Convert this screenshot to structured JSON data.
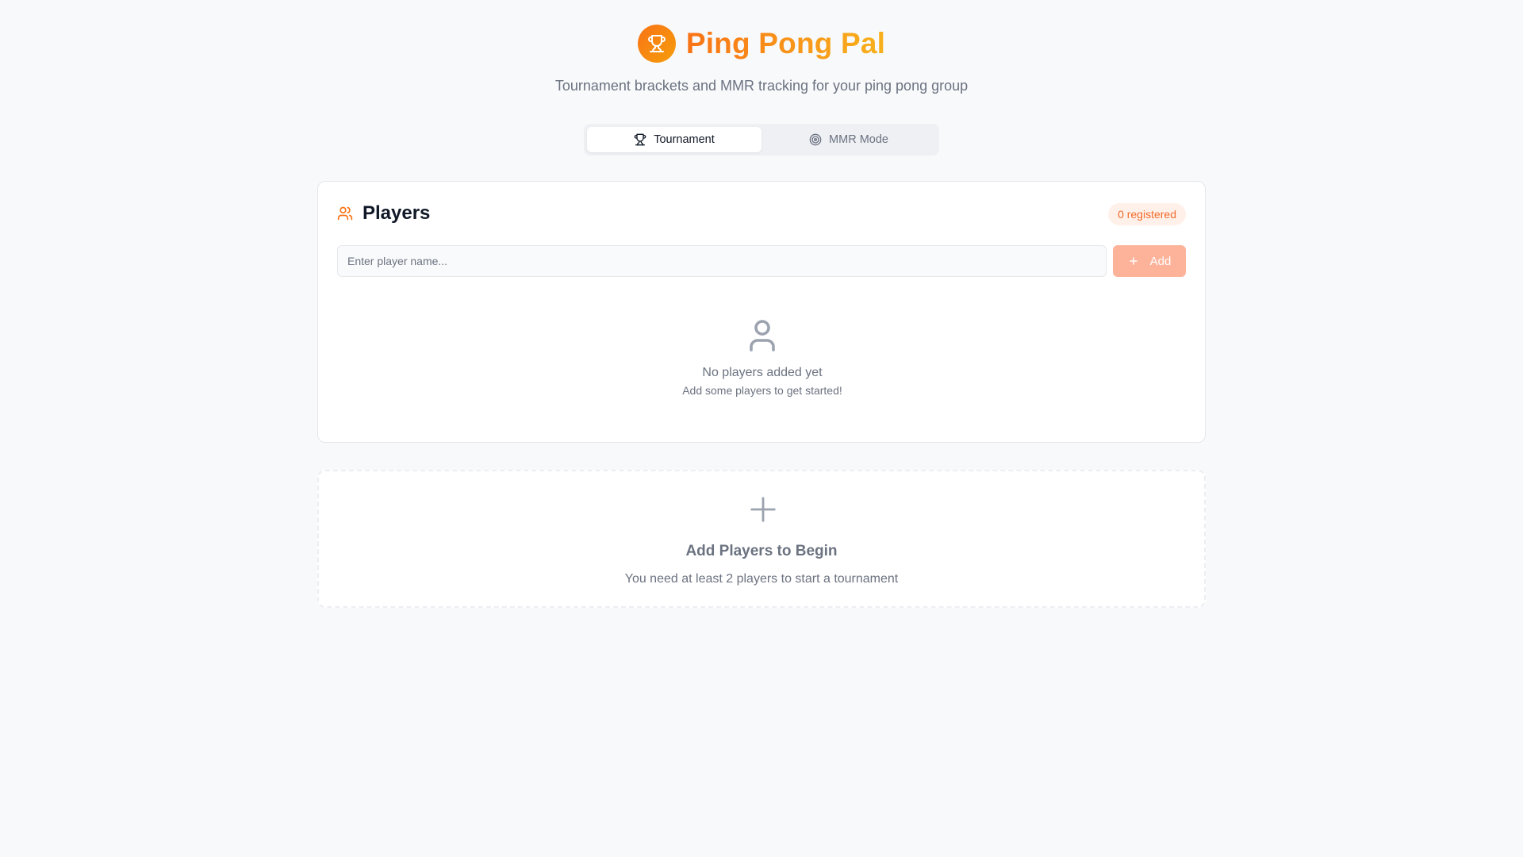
{
  "app": {
    "title": "Ping Pong Pal",
    "subtitle": "Tournament brackets and MMR tracking for your ping pong group"
  },
  "tabs": [
    {
      "label": "Tournament",
      "icon": "trophy-icon",
      "active": true
    },
    {
      "label": "MMR Mode",
      "icon": "target-icon",
      "active": false
    }
  ],
  "players_card": {
    "title": "Players",
    "badge": "0 registered",
    "input_placeholder": "Enter player name...",
    "add_label": "Add",
    "empty_title": "No players added yet",
    "empty_subtitle": "Add some players to get started!"
  },
  "cta": {
    "title": "Add Players to Begin",
    "subtitle": "You need at least 2 players to start a tournament"
  },
  "colors": {
    "accent": "#f97316",
    "accent_light": "#f59e0b",
    "badge_bg": "#fff1ea",
    "button_disabled": "#fdb39a",
    "page_bg": "#f8f9fb"
  }
}
